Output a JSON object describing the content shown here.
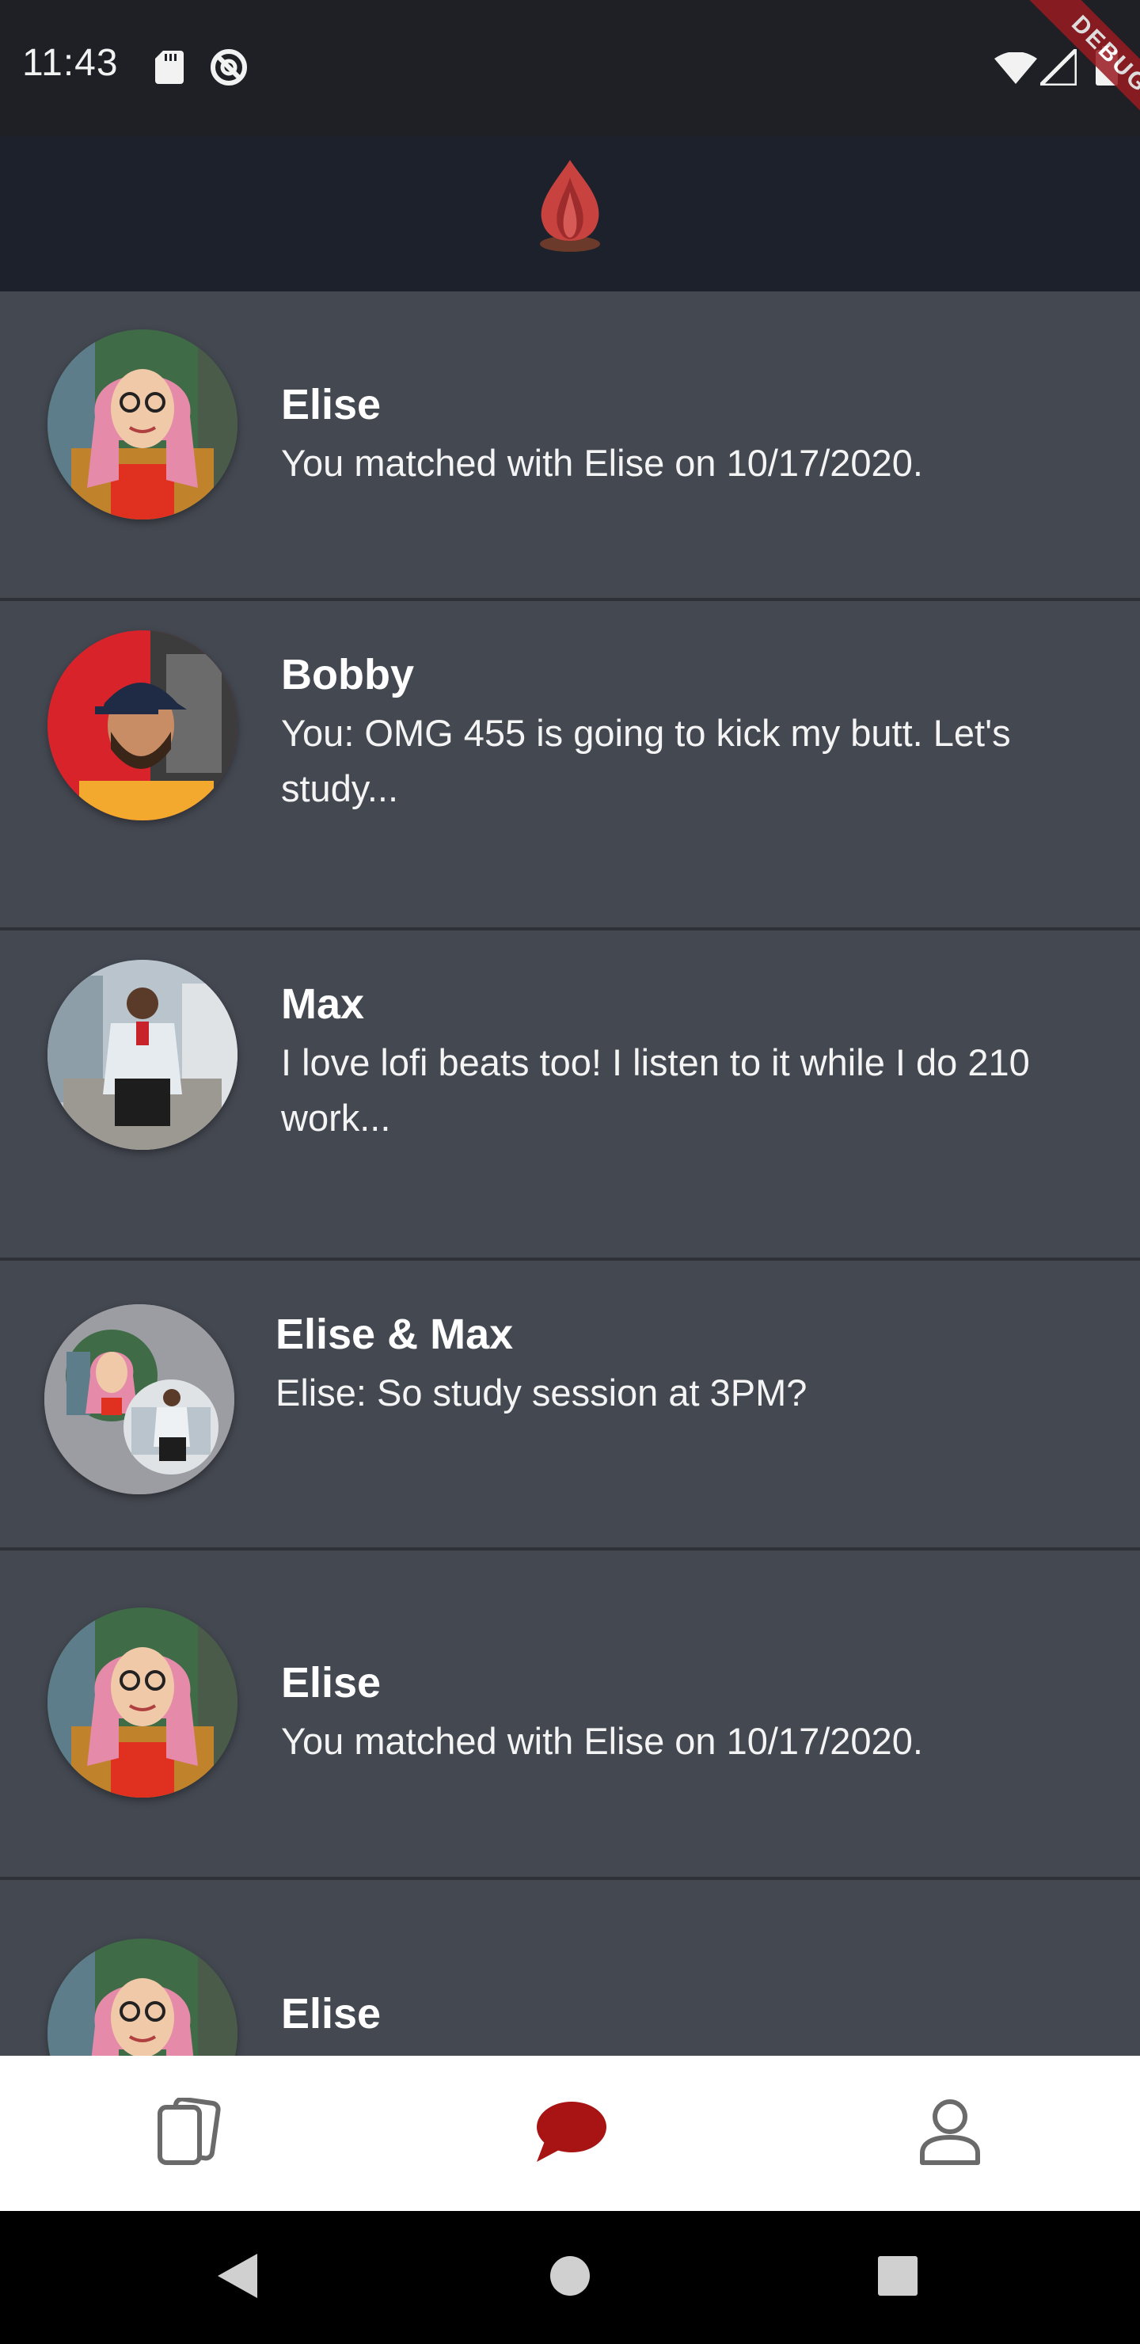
{
  "status_bar": {
    "time": "11:43",
    "debug_label": "DEBUG",
    "icons": [
      "sd-card-icon",
      "do-not-disturb-icon",
      "wifi-icon",
      "signal-icon",
      "battery-icon"
    ]
  },
  "header": {
    "logo_icon": "flame-logo-icon",
    "colors": {
      "flame": "#c8423f",
      "base": "#6b3a2a"
    }
  },
  "conversations": [
    {
      "name": "Elise",
      "preview": "You matched with Elise on 10/17/2020.",
      "avatar": "elise"
    },
    {
      "name": "Bobby",
      "preview": "You: OMG 455 is going to kick my butt. Let's study...",
      "avatar": "bobby"
    },
    {
      "name": "Max",
      "preview": "I love lofi beats too! I listen to it while I do 210 work...",
      "avatar": "max"
    },
    {
      "name": "Elise & Max",
      "preview": "Elise: So study session at 3PM?",
      "avatar": "group"
    },
    {
      "name": "Elise",
      "preview": "You matched with Elise on 10/17/2020.",
      "avatar": "elise"
    },
    {
      "name": "Elise",
      "preview": "",
      "avatar": "elise"
    }
  ],
  "bottom_nav": {
    "items": [
      {
        "icon": "cards-icon",
        "active": false
      },
      {
        "icon": "chat-bubble-icon",
        "active": true
      },
      {
        "icon": "profile-icon",
        "active": false
      }
    ],
    "active_color": "#a81414",
    "inactive_color": "#6a6a6a"
  },
  "system_nav": {
    "buttons": [
      "back-icon",
      "home-icon",
      "recents-icon"
    ]
  },
  "colors": {
    "status_bar": "#1e2026",
    "header": "#1d212b",
    "list_background": "#444851",
    "divider": "#2e3138"
  }
}
